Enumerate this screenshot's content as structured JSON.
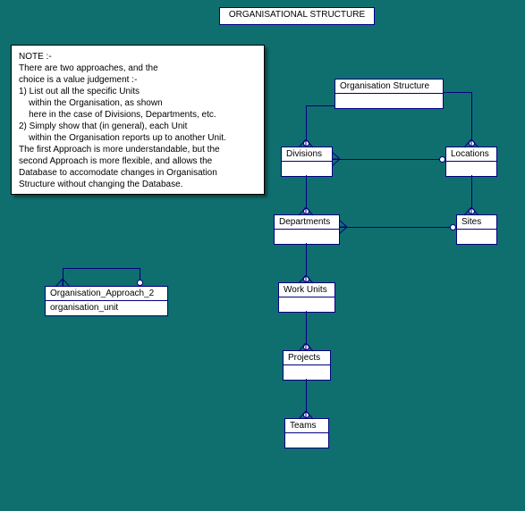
{
  "title": "ORGANISATIONAL STRUCTURE",
  "note": {
    "line1": "NOTE :-",
    "line2": "There are two approaches, and the",
    "line3": "choice is a value judgement :-",
    "line4": "1) List out all the specific Units",
    "line5": "    within the Organisation, as shown",
    "line6": "    here in the case of Divisions, Departments, etc.",
    "line7": "2) Simply show that (in general), each Unit",
    "line8": "    within the Organisation reports up to another Unit.",
    "line9": "",
    "line10": "The first Approach is more understandable, but the",
    "line11": "second Approach is more flexible, and allows the",
    "line12": "Database to accomodate changes in Organisation",
    "line13": "Structure without changing the Database."
  },
  "entities": {
    "orgStructure": "Organisation Structure",
    "divisions": "Divisions",
    "locations": "Locations",
    "departments": "Departments",
    "sites": "Sites",
    "workUnits": "Work Units",
    "projects": "Projects",
    "teams": "Teams",
    "approach2": "Organisation_Approach_2",
    "approach2attr": "organisation_unit"
  }
}
